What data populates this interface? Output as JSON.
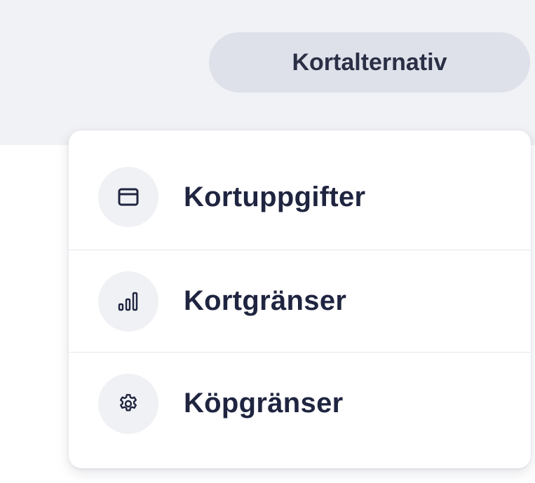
{
  "header": {
    "menu_button_label": "Kortalternativ"
  },
  "dropdown": {
    "items": [
      {
        "label": "Kortuppgifter",
        "icon": "credit-card-icon"
      },
      {
        "label": "Kortgränser",
        "icon": "bar-chart-icon"
      },
      {
        "label": "Köpgränser",
        "icon": "gear-icon"
      }
    ]
  },
  "colors": {
    "page_background": "#f1f2f5",
    "button_background": "#dfe1ea",
    "text": "#1f2540",
    "icon_circle": "#f0f1f4"
  }
}
